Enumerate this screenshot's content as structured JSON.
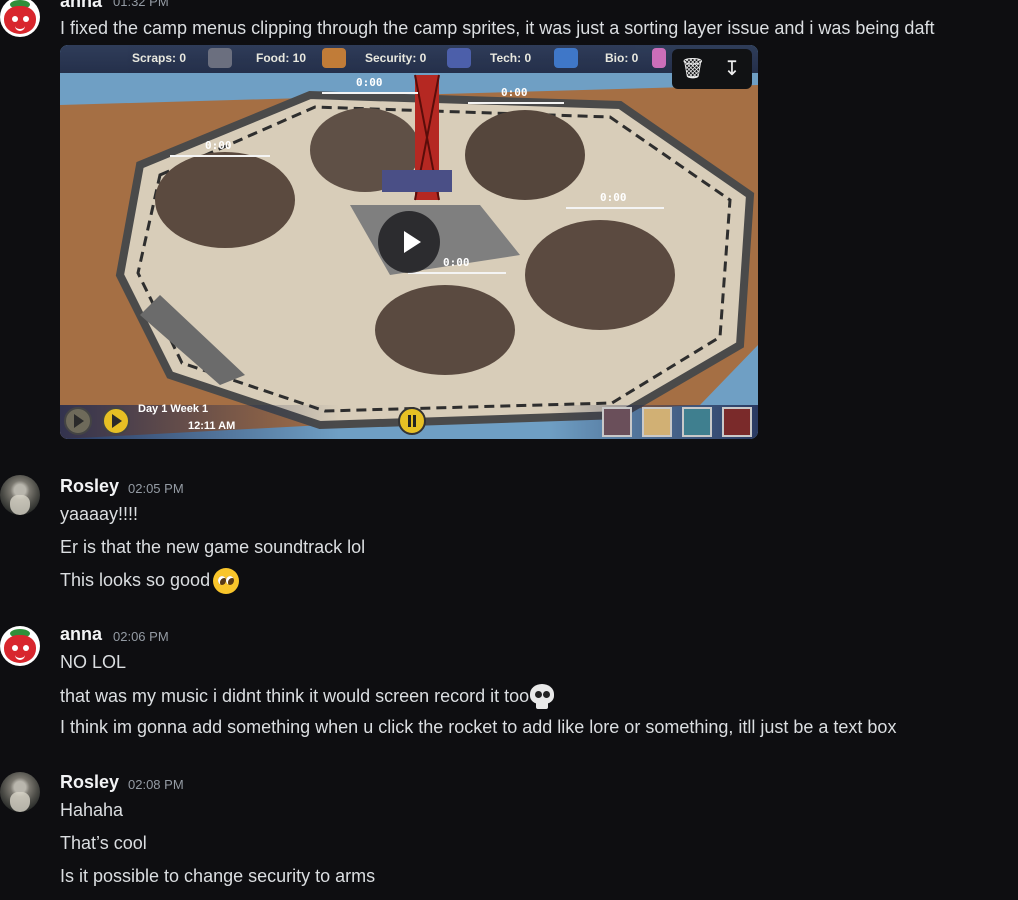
{
  "messages_top": {
    "author": "anna",
    "time": "01:32 PM",
    "text": "I fixed the camp menus clipping through the camp sprites, it was just a sorting layer issue and i was being daft"
  },
  "video": {
    "hud": {
      "scraps": "Scraps: 0",
      "food": "Food: 10",
      "security": "Security: 0",
      "tech": "Tech: 0",
      "bio": "Bio: 0"
    },
    "timers": [
      "0:00",
      "0:00",
      "0:00",
      "0:00",
      "0:00"
    ],
    "day_week": "Day 1  Week 1",
    "clock": "12:11 AM",
    "action_icons": [
      "trash-icon",
      "download-icon"
    ],
    "colors": {
      "accent_yellow": "#e7c024",
      "hud_bg": "#2a3450"
    }
  },
  "group_rosley_1": {
    "author": "Rosley",
    "time": "02:05 PM",
    "lines": [
      "yaaaay!!!!",
      "Er is that the new game soundtrack lol",
      "This looks so good"
    ]
  },
  "group_anna": {
    "author": "anna",
    "time": "02:06 PM",
    "lines": [
      "NO LOL",
      "that was my music i didnt think it would screen record it too",
      "I think im gonna add something when u click the rocket to add like lore or something, itll just be a text box"
    ]
  },
  "group_rosley_2": {
    "author": "Rosley",
    "time": "02:08 PM",
    "lines": [
      "Hahaha",
      "That’s cool",
      "Is it possible to change security to arms"
    ]
  }
}
